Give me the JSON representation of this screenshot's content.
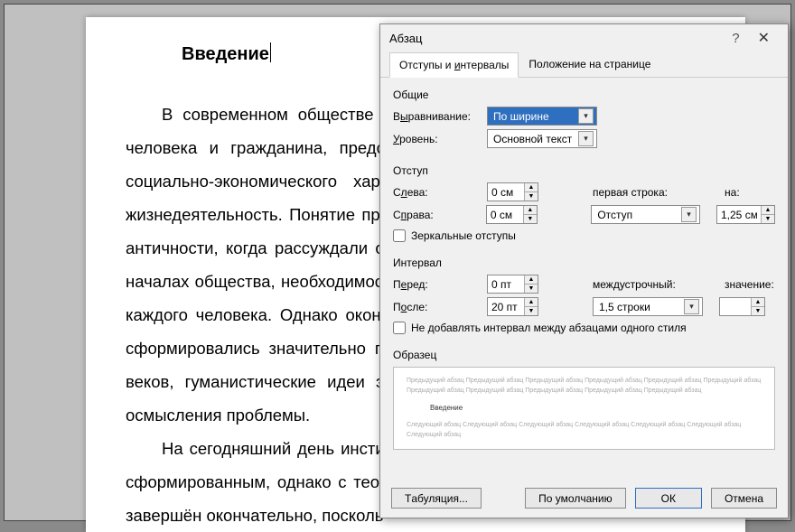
{
  "document": {
    "title": "Введение",
    "para1": "В современном обществе особую роль играют права и свободы человека и гражданина, представляющие блага личного, правового, социально-экономического характера, обеспечивающие нормальную жизнедеятельность. Понятие прав человека появилось еще во времена античности, когда рассуждали о морально-нравственных и социальных началах общества, необходимости защиты этих прав в равной мере для каждого человека. Однако окончательно права человека и гражданина сформировались значительно позже — религиозные догматы средних веков, гуманистические идеи эпохи возрождения, попытки правового осмысления проблемы.",
    "para2": "На сегодняшний день институт прав человека считается полностью сформированным, однако с теоретической точки зрения не может быть завершён окончательно, посколь-"
  },
  "dialog": {
    "title": "Абзац",
    "tabs": {
      "indents": "Отступы и интервалы",
      "position": "Положение на странице"
    },
    "general": {
      "title": "Общие",
      "align_label": "Выравнивание:",
      "align_value": "По ширине",
      "level_label": "Уровень:",
      "level_value": "Основной текст"
    },
    "indent": {
      "title": "Отступ",
      "left_label": "Слева:",
      "left_value": "0 см",
      "right_label": "Справа:",
      "right_value": "0 см",
      "first_label": "первая строка:",
      "first_value": "Отступ",
      "by_label": "на:",
      "by_value": "1,25 см",
      "mirror_label": "Зеркальные отступы"
    },
    "spacing": {
      "title": "Интервал",
      "before_label": "Перед:",
      "before_value": "0 пт",
      "after_label": "После:",
      "after_value": "20 пт",
      "line_label": "междустрочный:",
      "line_value": "1,5 строки",
      "at_label": "значение:",
      "at_value": "",
      "nospace_label": "Не добавлять интервал между абзацами одного стиля"
    },
    "sample": {
      "title": "Образец",
      "prev": "Предыдущий абзац Предыдущий абзац Предыдущий абзац Предыдущий абзац Предыдущий абзац Предыдущий абзац Предыдущий абзац Предыдущий абзац Предыдущий абзац Предыдущий абзац Предыдущий абзац",
      "focus": "Введение",
      "next": "Следующий абзац Следующий абзац Следующий абзац Следующий абзац Следующий абзац Следующий абзац Следующий абзац"
    },
    "buttons": {
      "tabs": "Табуляция...",
      "default": "По умолчанию",
      "ok": "ОК",
      "cancel": "Отмена"
    }
  }
}
